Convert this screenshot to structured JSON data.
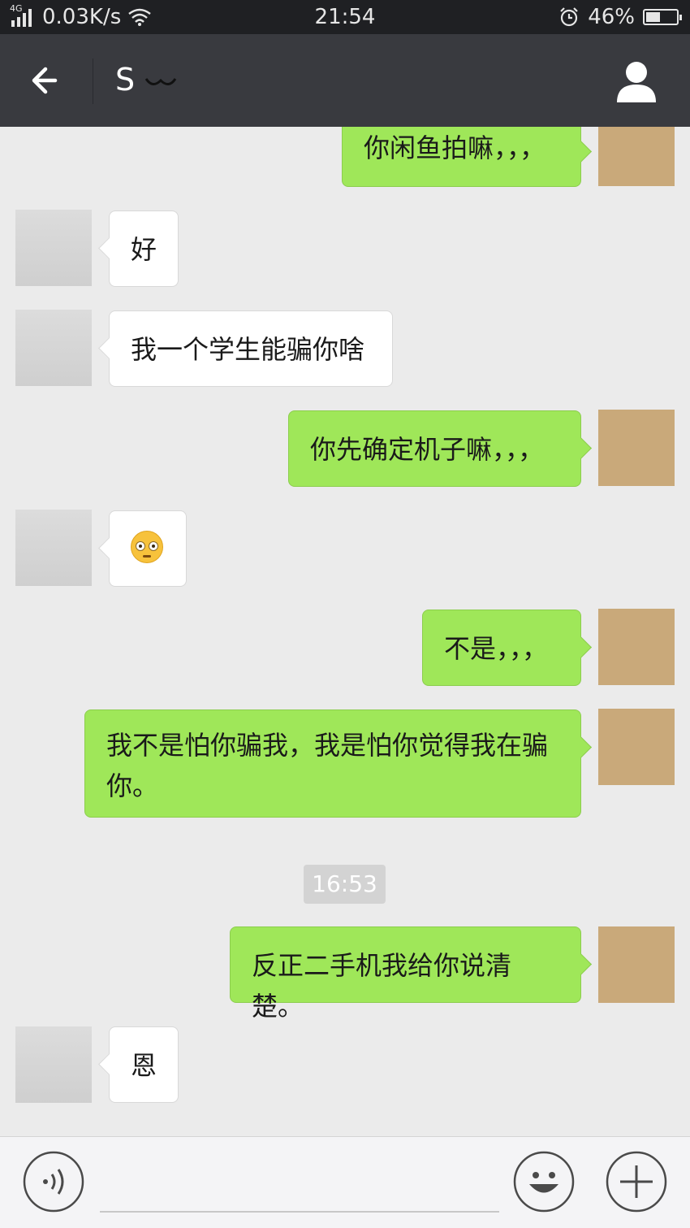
{
  "status_bar": {
    "network_type": "4G",
    "net_speed": "0.03K/s",
    "time": "21:54",
    "battery_percent": "46%",
    "battery_level": 0.46,
    "icons": [
      "signal-icon",
      "wifi-icon",
      "alarm-icon",
      "battery-icon"
    ]
  },
  "header": {
    "title": "S",
    "back_icon": "arrow-left-icon",
    "profile_icon": "person-icon"
  },
  "messages": [
    {
      "side": "out",
      "text": "你闲鱼拍嘛，，，"
    },
    {
      "side": "in",
      "text": "好"
    },
    {
      "side": "in",
      "text": "我一个学生能骗你啥"
    },
    {
      "side": "out",
      "text": "你先确定机子嘛，，，"
    },
    {
      "side": "in",
      "emoji": "flushed-face-emoji"
    },
    {
      "side": "out",
      "text": "不是，，，"
    },
    {
      "side": "out",
      "text_line1": "我不是怕你骗我，我是怕你觉得我在骗",
      "text_line2": "你。"
    },
    {
      "timestamp": "16:53"
    },
    {
      "side": "out",
      "text": "反正二手机我给你说清楚。"
    },
    {
      "side": "in",
      "text": "恩"
    }
  ],
  "input_bar": {
    "voice_icon": "voice-icon",
    "emoji_icon": "smiley-icon",
    "plus_icon": "plus-icon"
  },
  "colors": {
    "status_bg": "#1f2023",
    "header_bg": "#393a3f",
    "chat_bg": "#ebebeb",
    "outgoing_bubble": "#9fe759",
    "incoming_bubble": "#ffffff"
  }
}
